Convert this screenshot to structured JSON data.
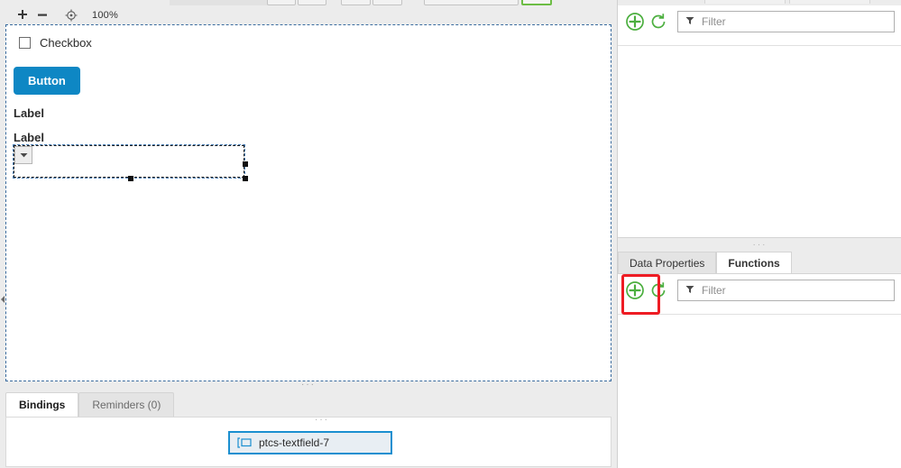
{
  "toolbar": {
    "zoom_in_icon": "plus-icon",
    "zoom_out_icon": "minus-icon",
    "zoom_reset_icon": "target-icon",
    "zoom_level": "100%"
  },
  "canvas": {
    "checkbox": {
      "label": "Checkbox",
      "checked": false
    },
    "button": {
      "label": "Button",
      "color": "#0e87c4"
    },
    "labels": [
      {
        "text": "Label"
      },
      {
        "text": "Label"
      }
    ],
    "dropdown": {
      "value": "",
      "selected": true,
      "arrow_icon": "caret-down-icon"
    },
    "grip": "···",
    "selection_color": "#4a7fb5"
  },
  "bindings_panel": {
    "tabs": [
      {
        "label": "Bindings",
        "active": true
      },
      {
        "label": "Reminders (0)",
        "active": false
      }
    ],
    "chip": {
      "label": "ptcs-textfield-7",
      "icon": "widget-icon",
      "border_color": "#1a8fd0"
    },
    "grip": "···"
  },
  "right_panel": {
    "top_section": {
      "add_icon": "plus-circle-icon",
      "refresh_icon": "refresh-circle-icon",
      "filter": {
        "icon": "funnel-icon",
        "placeholder": "Filter",
        "value": ""
      }
    },
    "splitter_grip": "···",
    "tabs": [
      {
        "label": "Data Properties",
        "active": false
      },
      {
        "label": "Functions",
        "active": true
      }
    ],
    "bottom_section": {
      "add_icon": "plus-circle-icon",
      "refresh_icon": "refresh-circle-icon",
      "filter": {
        "icon": "funnel-icon",
        "placeholder": "Filter",
        "value": ""
      },
      "highlight_color": "#ee1c24"
    }
  },
  "colors": {
    "accent_blue": "#0e87c4",
    "green": "#4caf3f",
    "red_annotation": "#ee1c24",
    "panel_bg": "#ececec"
  }
}
